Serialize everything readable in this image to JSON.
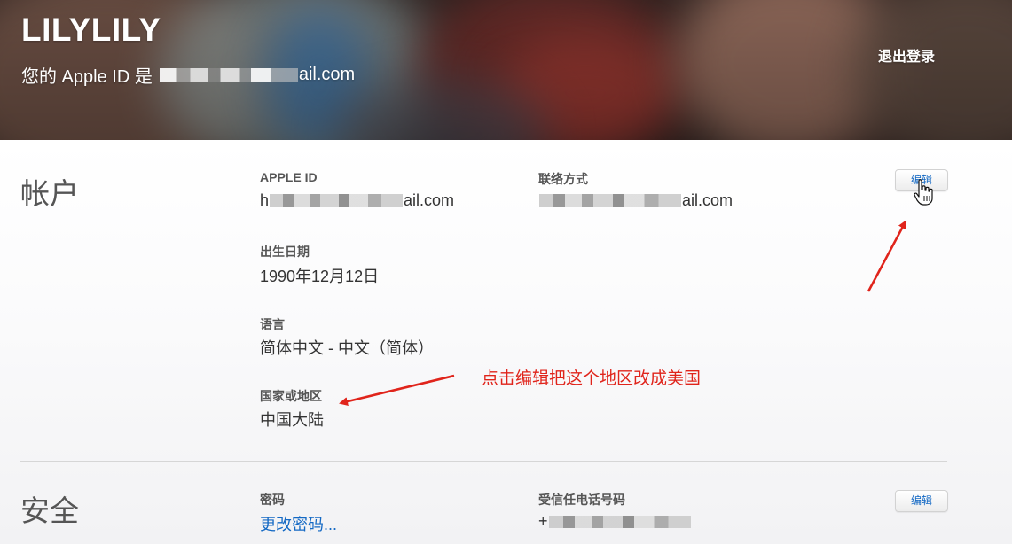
{
  "header": {
    "user_name": "LILYLILY",
    "apple_id_prefix": "您的 Apple ID 是",
    "apple_id_suffix": "ail.com",
    "logout_label": "退出登录"
  },
  "account": {
    "section_title": "帐户",
    "edit_label": "编辑",
    "apple_id_label": "APPLE ID",
    "apple_id_value_start": "h",
    "apple_id_value_end": "ail.com",
    "contact_label": "联络方式",
    "contact_value_end": "ail.com",
    "birthday_label": "出生日期",
    "birthday_value": "1990年12月12日",
    "language_label": "语言",
    "language_value": "简体中文 - 中文（简体）",
    "region_label": "国家或地区",
    "region_value": "中国大陆"
  },
  "annotation": {
    "text": "点击编辑把这个地区改成美国",
    "color": "#e0241b"
  },
  "security": {
    "section_title": "安全",
    "edit_label": "编辑",
    "password_label": "密码",
    "password_link": "更改密码...",
    "phone_label": "受信任电话号码",
    "phone_prefix": "+"
  },
  "colors": {
    "link": "#1469c4",
    "label": "#555555",
    "value": "#333333"
  }
}
